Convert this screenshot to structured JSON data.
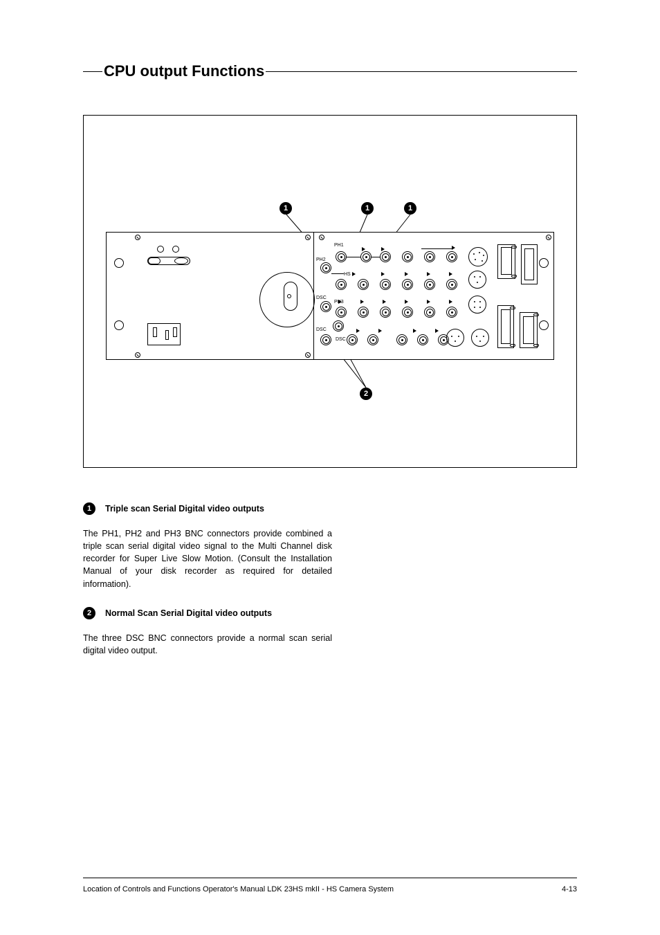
{
  "title": "CPU output Functions",
  "callouts": {
    "one": "1",
    "two": "2"
  },
  "panel_labels": {
    "ph1": "PH1",
    "ph2": "PH2",
    "ph3": "PH3",
    "dsc": "DSC",
    "hs": "HS"
  },
  "sections": [
    {
      "badge": "1",
      "heading": "Triple scan Serial Digital video outputs",
      "body": "The PH1, PH2 and PH3 BNC connectors  provide combined a triple scan serial digital video signal to the Multi Channel disk recorder for Super Live Slow Motion. (Consult the Installation Manual of your disk recorder as required for detailed information)."
    },
    {
      "badge": "2",
      "heading": "Normal Scan Serial Digital video outputs",
      "body": "The three DSC BNC connectors provide a normal scan serial digital video output."
    }
  ],
  "footer": {
    "left": "Location of Controls and Functions     Operator's Manual LDK 23HS mkII - HS Camera System",
    "right": "4-13"
  }
}
